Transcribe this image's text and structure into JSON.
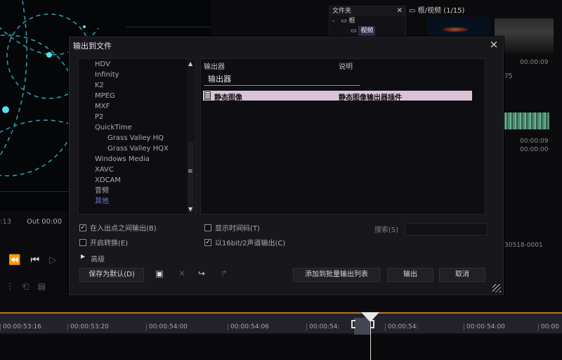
{
  "background": {
    "timecode": ":13",
    "out_label": "Out 00:00",
    "folder_panel": {
      "title": "文件夹",
      "tree": [
        "根",
        "视频"
      ]
    },
    "bin_title": "根/视频 (1/15)",
    "bin_meta": [
      "00:00:09",
      "75",
      "00:00:09",
      "00:00:00",
      "30518-0001"
    ]
  },
  "dialog": {
    "title": "输出到文件",
    "format_list": [
      {
        "label": "HDV",
        "sub": false,
        "selected": false
      },
      {
        "label": "Infinity",
        "sub": false,
        "selected": false
      },
      {
        "label": "K2",
        "sub": false,
        "selected": false
      },
      {
        "label": "MPEG",
        "sub": false,
        "selected": false
      },
      {
        "label": "MXF",
        "sub": false,
        "selected": false
      },
      {
        "label": "P2",
        "sub": false,
        "selected": false
      },
      {
        "label": "QuickTime",
        "sub": false,
        "selected": false
      },
      {
        "label": "Grass Valley HQ",
        "sub": true,
        "selected": false
      },
      {
        "label": "Grass Valley HQX",
        "sub": true,
        "selected": false
      },
      {
        "label": "Windows Media",
        "sub": false,
        "selected": false
      },
      {
        "label": "XAVC",
        "sub": false,
        "selected": false
      },
      {
        "label": "XDCAM",
        "sub": false,
        "selected": false
      },
      {
        "label": "音频",
        "sub": false,
        "selected": false
      },
      {
        "label": "其他",
        "sub": false,
        "selected": true
      }
    ],
    "exporter": {
      "col_exporter": "输出器",
      "col_description": "说明",
      "group_label": "输出器",
      "selected_name": "静态图像",
      "selected_desc": "静态图像输出器插件"
    },
    "options": {
      "between_in_out": {
        "label": "在入出点之间输出(B)",
        "checked": true
      },
      "enable_conversion": {
        "label": "开启转换(E)",
        "checked": false
      },
      "show_timecode": {
        "label": "显示时间码(T)",
        "checked": false
      },
      "audio_16bit": {
        "label": "以16bit/2声道输出(C)",
        "checked": true
      }
    },
    "search": {
      "label": "搜索(S)",
      "value": ""
    },
    "advanced_label": "高级",
    "buttons": {
      "save_default": "保存为默认(D)",
      "add_batch": "添加到批量输出列表",
      "export": "输出",
      "cancel": "取消"
    }
  },
  "timeline": {
    "timecodes": [
      "00:00:53:16",
      "00:00:53:20",
      "00:00:54:00",
      "00:00:54:06",
      "00:00:54:",
      "00:00:54:",
      "00:00:54:00",
      "00:00"
    ]
  }
}
